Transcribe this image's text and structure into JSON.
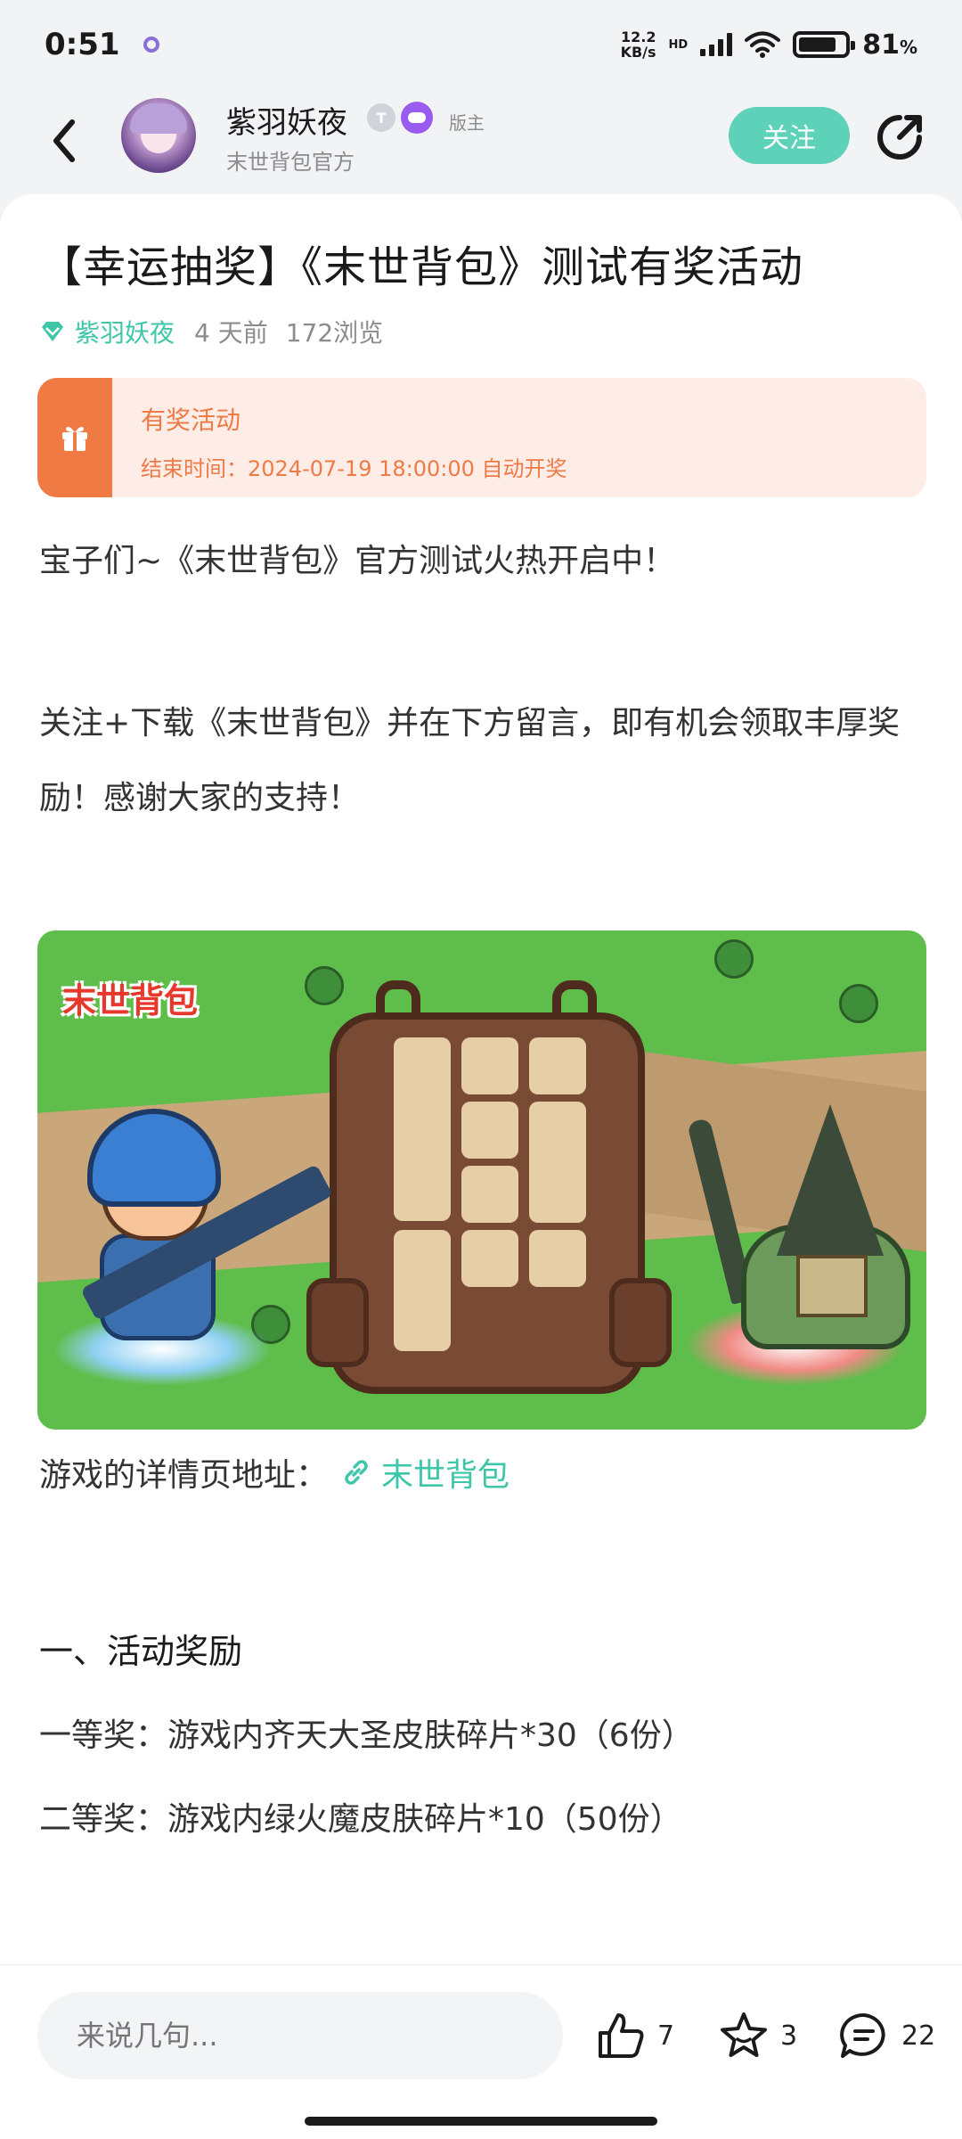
{
  "status_bar": {
    "time": "0:51",
    "net_speed_value": "12.2",
    "net_speed_unit": "KB/s",
    "hd_label": "HD",
    "battery_percent": "81",
    "battery_unit": "%"
  },
  "header": {
    "author_name": "紫羽妖夜",
    "role_tag": "版主",
    "author_sub": "末世背包官方",
    "follow_label": "关注",
    "badge_t": "T"
  },
  "post": {
    "title": "【幸运抽奖】《末世背包》测试有奖活动",
    "author": "紫羽妖夜",
    "time": "4 天前",
    "views": "172浏览",
    "prize_box": {
      "label": "有奖活动",
      "end_time": "结束时间：2024-07-19 18:00:00 自动开奖"
    },
    "paragraph1": "宝子们~《末世背包》官方测试火热开启中！",
    "paragraph2": "关注+下载《末世背包》并在下方留言，即有机会领取丰厚奖励！感谢大家的支持！",
    "banner_logo": "末世背包",
    "link_prefix": "游戏的详情页地址：",
    "link_text": "末世背包",
    "section_title": "一、活动奖励",
    "prize_first": "一等奖：游戏内齐天大圣皮肤碎片*30（6份）",
    "prize_second": "二等奖：游戏内绿火魔皮肤碎片*10（50份）"
  },
  "bottom_bar": {
    "comment_placeholder": "来说几句...",
    "likes": "7",
    "favorites": "3",
    "comments": "22"
  },
  "colors": {
    "accent": "#3fc6a8",
    "follow_button": "#5ed1b9",
    "prize_orange": "#f07a43",
    "prize_bg": "#fdede6"
  },
  "icons": [
    "back-icon",
    "share-icon",
    "gem-icon",
    "gift-icon",
    "link-icon",
    "like-icon",
    "star-icon",
    "comment-icon"
  ]
}
